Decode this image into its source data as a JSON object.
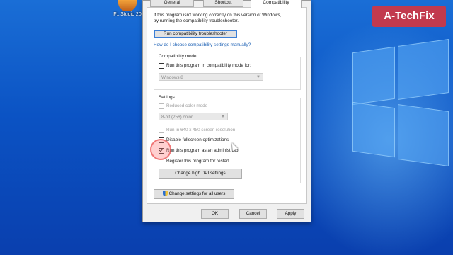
{
  "desktop": {
    "icon_label": "FL Studio 20",
    "brand": "A-TechFix"
  },
  "dialog": {
    "tabs": [
      {
        "label": "General"
      },
      {
        "label": "Shortcut"
      },
      {
        "label": "Compatibility",
        "active": true
      }
    ],
    "intro_line1": "If this program isn't working correctly on this version of Windows,",
    "intro_line2": "try running the compatibility troubleshooter.",
    "troubleshooter_button": "Run compatibility troubleshooter",
    "help_link": "How do I choose compatibility settings manually?",
    "compat_mode": {
      "title": "Compatibility mode",
      "checkbox_label": "Run this program in compatibility mode for:",
      "checked": false,
      "select_value": "Windows 8"
    },
    "settings": {
      "title": "Settings",
      "reduced_color": {
        "label": "Reduced color mode",
        "checked": false,
        "enabled": false
      },
      "color_select": "8-bit (256) color",
      "resolution": {
        "label": "Run in 640 x 480 screen resolution",
        "checked": false,
        "enabled": false
      },
      "fullscreen": {
        "label": "Disable fullscreen optimizations",
        "checked": false
      },
      "admin": {
        "label": "Run this program as an administrator",
        "checked": true
      },
      "restart": {
        "label": "Register this program for restart",
        "checked": false
      },
      "dpi_button": "Change high DPI settings"
    },
    "all_users_button": "Change settings for all users",
    "footer": {
      "ok": "OK",
      "cancel": "Cancel",
      "apply": "Apply"
    }
  }
}
